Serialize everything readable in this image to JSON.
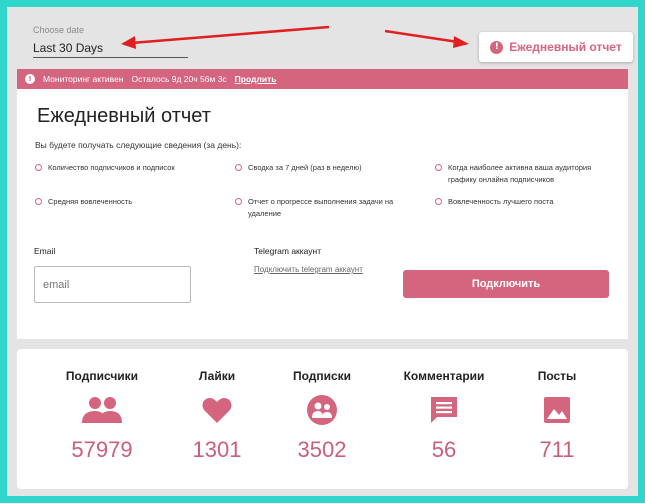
{
  "header": {
    "date_label": "Choose date",
    "date_value": "Last 30 Days",
    "daily_report_button": "Ежедневный отчет"
  },
  "monitor": {
    "status": "Мониторинг активен",
    "remaining": "Осталось 9д 20ч 56м 3с",
    "extend": "Продлить"
  },
  "report": {
    "title": "Ежедневный отчет",
    "subtitle": "Вы будете получать следующие сведения (за день):",
    "features": [
      "Количество подписчиков и подписок",
      "Сводка за 7 дней (раз в неделю)",
      "Когда наиболее активна ваша аудитория графику онлайна подписчиков",
      "Средняя вовлеченность",
      "Отчет о прогрессе выполнения задачи на удаление",
      "Вовлеченность лучшего поста"
    ],
    "email_label": "Email",
    "email_placeholder": "email",
    "telegram_label": "Telegram аккаунт",
    "telegram_link": "Подключить telegram аккаунт",
    "connect_button": "Подключить"
  },
  "stats": [
    {
      "title": "Подписчики",
      "icon": "followers-icon",
      "value": "57979"
    },
    {
      "title": "Лайки",
      "icon": "heart-icon",
      "value": "1301"
    },
    {
      "title": "Подписки",
      "icon": "following-icon",
      "value": "3502"
    },
    {
      "title": "Комментарии",
      "icon": "comment-icon",
      "value": "56"
    },
    {
      "title": "Посты",
      "icon": "image-icon",
      "value": "711"
    }
  ],
  "colors": {
    "accent": "#d5657f",
    "frame": "#2fd6c9",
    "arrows": "#e02020"
  }
}
